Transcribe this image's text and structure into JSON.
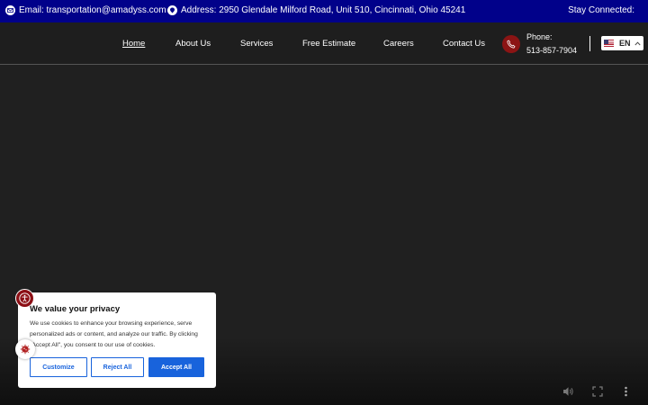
{
  "topbar": {
    "email": "Email: transportation@amadyss.com",
    "address": "Address: 2950 Glendale Milford Road, Unit 510, Cincinnati, Ohio 45241",
    "stay_connected": "Stay Connected:",
    "email_icon": "email-icon",
    "address_icon": "location-icon"
  },
  "nav": {
    "items": [
      {
        "label": "Home",
        "active": true
      },
      {
        "label": "About Us"
      },
      {
        "label": "Services"
      },
      {
        "label": "Free Estimate"
      },
      {
        "label": "Careers"
      },
      {
        "label": "Contact Us"
      }
    ],
    "phone_label": "Phone:",
    "phone_number": "513-857-7904",
    "phone_icon": "phone-icon",
    "language": "EN",
    "flag_icon": "us-flag-icon"
  },
  "cookie": {
    "title": "We value your privacy",
    "body": "We use cookies to enhance your browsing experience, serve personalized ads or content, and analyze our traffic. By clicking \"Accept All\", you consent to our use of cookies.",
    "customize": "Customize",
    "reject": "Reject All",
    "accept": "Accept All"
  },
  "video_controls": [
    "volume-icon",
    "fullscreen-icon",
    "more-options-icon"
  ],
  "colors": {
    "topbar_bg": "#01018a",
    "accent_red": "#8b1414",
    "button_blue": "#1863dc"
  }
}
